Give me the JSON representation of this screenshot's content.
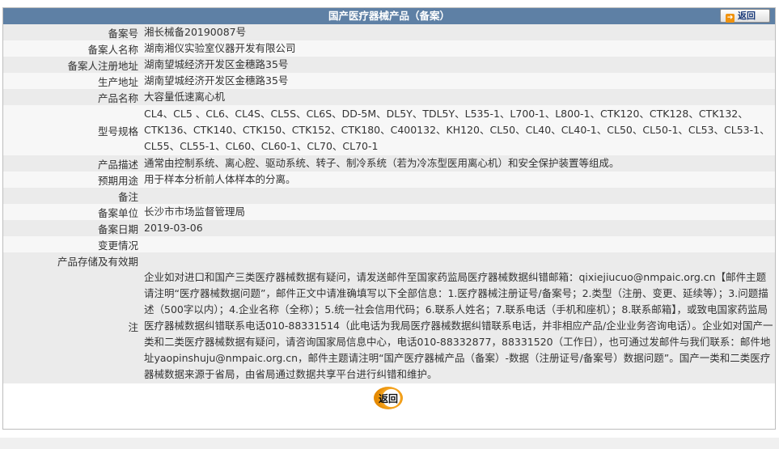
{
  "header": {
    "title": "国产医疗器械产品（备案）",
    "back_label": "返回"
  },
  "rows": [
    {
      "label": "备案号",
      "value": "湘长械备20190087号"
    },
    {
      "label": "备案人名称",
      "value": "湖南湘仪实验室仪器开发有限公司"
    },
    {
      "label": "备案人注册地址",
      "value": "湖南望城经济开发区金穗路35号"
    },
    {
      "label": "生产地址",
      "value": "湖南望城经济开发区金穗路35号"
    },
    {
      "label": "产品名称",
      "value": "大容量低速离心机"
    },
    {
      "label": "型号规格",
      "value": "CL4、CL5 、CL6、CL4S、CL5S、CL6S、DD-5M、DL5Y、TDL5Y、L535-1、L700-1、L800-1、CTK120、CTK128、CTK132、CTK136、CTK140、CTK150、CTK152、CTK180、C400132、KH120、CL50、CL40、CL40-1、CL50、CL50-1、CL53、CL53-1、CL55、CL55-1、CL60、CL60-1、CL70、CL70-1"
    },
    {
      "label": "产品描述",
      "value": "通常由控制系统、离心腔、驱动系统、转子、制冷系统（若为冷冻型医用离心机）和安全保护装置等组成。"
    },
    {
      "label": "预期用途",
      "value": "用于样本分析前人体样本的分离。"
    },
    {
      "label": "备注",
      "value": ""
    },
    {
      "label": "备案单位",
      "value": "长沙市市场监督管理局"
    },
    {
      "label": "备案日期",
      "value": "2019-03-06"
    },
    {
      "label": "变更情况",
      "value": ""
    },
    {
      "label": "产品存储及有效期",
      "value": ""
    },
    {
      "label": "注",
      "value": "企业如对进口和国产三类医疗器械数据有疑问，请发送邮件至国家药监局医疗器械数据纠错邮箱：qixiejiucuo@nmpaic.org.cn【邮件主题请注明“医疗器械数据问题”，邮件正文中请准确填写以下全部信息：1.医疗器械注册证号/备案号；2.类型（注册、变更、延续等）；3.问题描述（500字以内）；4.企业名称（全称）；5.统一社会信用代码；6.联系人姓名；7.联系电话（手机和座机）；8.联系邮箱】，或致电国家药监局医疗器械数据纠错联系电话010-88331514（此电话为我局医疗器械数据纠错联系电话，并非相应产品/企业业务咨询电话）。企业如对国产一类和二类医疗器械数据有疑问，请咨询国家局信息中心，电话010-88332877，88331520（工作日），也可通过发邮件与我们联系：邮件地址yaopinshuju@nmpaic.org.cn，邮件主题请注明“国产医疗器械产品（备案）-数据（注册证号/备案号）数据问题”。国产一类和二类医疗器械数据来源于省局，由省局通过数据共享平台进行纠错和维护。"
    }
  ],
  "footer": {
    "back_label": "返回"
  },
  "colors": {
    "title_bar": "#5e80a5",
    "row_dark": "#ebebeb",
    "row_light": "#f7f7f7",
    "accent_orange": "#f0920e"
  }
}
